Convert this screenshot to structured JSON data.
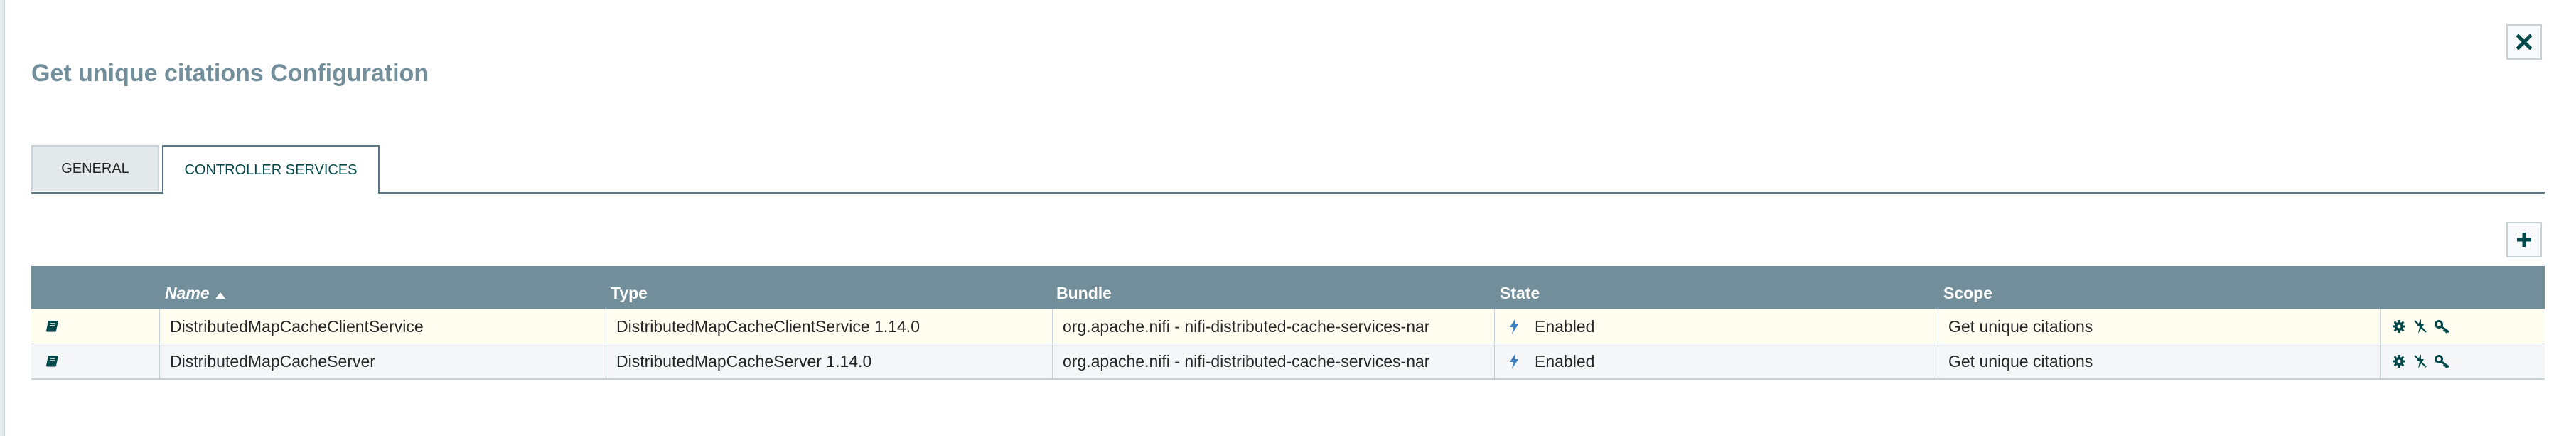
{
  "dialog": {
    "title": "Get unique citations Configuration"
  },
  "tabs": [
    {
      "label": "GENERAL",
      "active": false
    },
    {
      "label": "CONTROLLER SERVICES",
      "active": true
    }
  ],
  "table": {
    "columns": [
      "Name",
      "Type",
      "Bundle",
      "State",
      "Scope"
    ],
    "sorted_by": "Name",
    "sort_direction": "ascending",
    "rows": [
      {
        "name": "DistributedMapCacheClientService",
        "type": "DistributedMapCacheClientService 1.14.0",
        "bundle": "org.apache.nifi - nifi-distributed-cache-services-nar",
        "state": "Enabled",
        "scope": "Get unique citations"
      },
      {
        "name": "DistributedMapCacheServer",
        "type": "DistributedMapCacheServer 1.14.0",
        "bundle": "org.apache.nifi - nifi-distributed-cache-services-nar",
        "state": "Enabled",
        "scope": "Get unique citations"
      }
    ],
    "row_icons": [
      "documentation-icon",
      "configure-gear-icon",
      "disable-icon",
      "access-policies-key-icon"
    ]
  },
  "icons": {
    "close": "close-icon",
    "add": "plus-icon",
    "state": "lightning-bolt-icon"
  },
  "colors": {
    "header_bg": "#728e9b",
    "tab_border": "#587783",
    "title": "#728e9b",
    "state_bolt": "#3b82c4",
    "row_highlight": "#fffcf0"
  }
}
